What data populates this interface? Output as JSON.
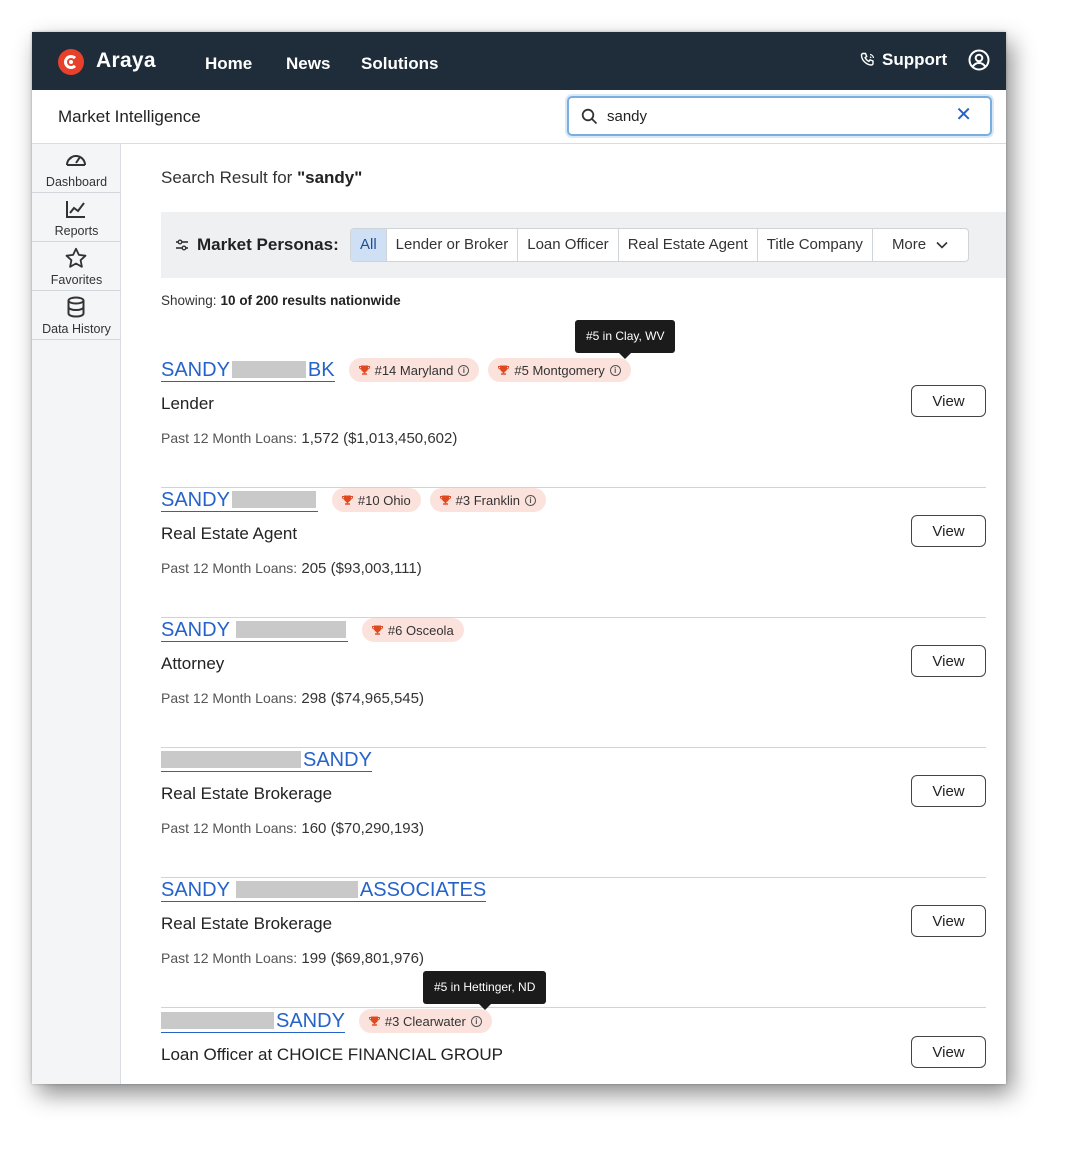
{
  "brand": {
    "name": "Araya"
  },
  "nav": {
    "home": "Home",
    "news": "News",
    "solutions": "Solutions",
    "support": "Support"
  },
  "subheader": {
    "title": "Market Intelligence"
  },
  "search": {
    "value": "sandy",
    "placeholder": ""
  },
  "sidebar": {
    "items": [
      {
        "label": "Dashboard",
        "icon": "gauge-icon"
      },
      {
        "label": "Reports",
        "icon": "chart-line-icon"
      },
      {
        "label": "Favorites",
        "icon": "star-icon"
      },
      {
        "label": "Data History",
        "icon": "database-icon"
      }
    ]
  },
  "results_header": {
    "prefix": "Search Result for ",
    "query": "\"sandy\""
  },
  "filter": {
    "label": "Market Personas:",
    "chips": [
      "All",
      "Lender or Broker",
      "Loan Officer",
      "Real Estate Agent",
      "Title Company"
    ],
    "more": "More",
    "active": "All"
  },
  "showing": {
    "label": "Showing:",
    "value": "10 of 200 results nationwide"
  },
  "colors": {
    "nav_bg": "#1f2d3a",
    "brand_red": "#e8412b",
    "link_blue": "#2563c9",
    "badge_bg": "#fbe2dc",
    "active_chip": "#cfe0f5"
  },
  "results": [
    {
      "name_prefix": "SANDY",
      "name_suffix": "BK",
      "role": "Lender",
      "loans_label": "Past 12 Month Loans:",
      "loans_value": "1,572 ($1,013,450,602)",
      "badges": [
        "#14 Maryland",
        "#5 Montgomery"
      ],
      "view": "View"
    },
    {
      "name_prefix": "SANDY",
      "name_suffix": "",
      "role": "Real Estate Agent",
      "loans_label": "Past 12 Month Loans:",
      "loans_value": "205 ($93,003,111)",
      "badges": [
        "#10 Ohio",
        "#3 Franklin"
      ],
      "view": "View"
    },
    {
      "name_prefix": "SANDY",
      "name_suffix": "",
      "role": "Attorney",
      "loans_label": "Past 12 Month Loans:",
      "loans_value": "298 ($74,965,545)",
      "badges": [
        "#6 Osceola"
      ],
      "view": "View"
    },
    {
      "name_prefix": "",
      "name_suffix": "SANDY",
      "role": "Real Estate Brokerage",
      "loans_label": "Past 12 Month Loans:",
      "loans_value": "160 ($70,290,193)",
      "badges": [],
      "view": "View"
    },
    {
      "name_prefix": "SANDY",
      "name_suffix": "ASSOCIATES",
      "role": "Real Estate Brokerage",
      "loans_label": "Past 12 Month Loans:",
      "loans_value": "199 ($69,801,976)",
      "badges": [],
      "view": "View"
    },
    {
      "name_prefix": "",
      "name_suffix": "SANDY",
      "role": "Loan Officer at CHOICE FINANCIAL GROUP",
      "badges": [
        "#3 Clearwater"
      ],
      "view": "View"
    }
  ],
  "tooltips": [
    "#5 in Clay, WV",
    "#5 in Hettinger, ND"
  ]
}
